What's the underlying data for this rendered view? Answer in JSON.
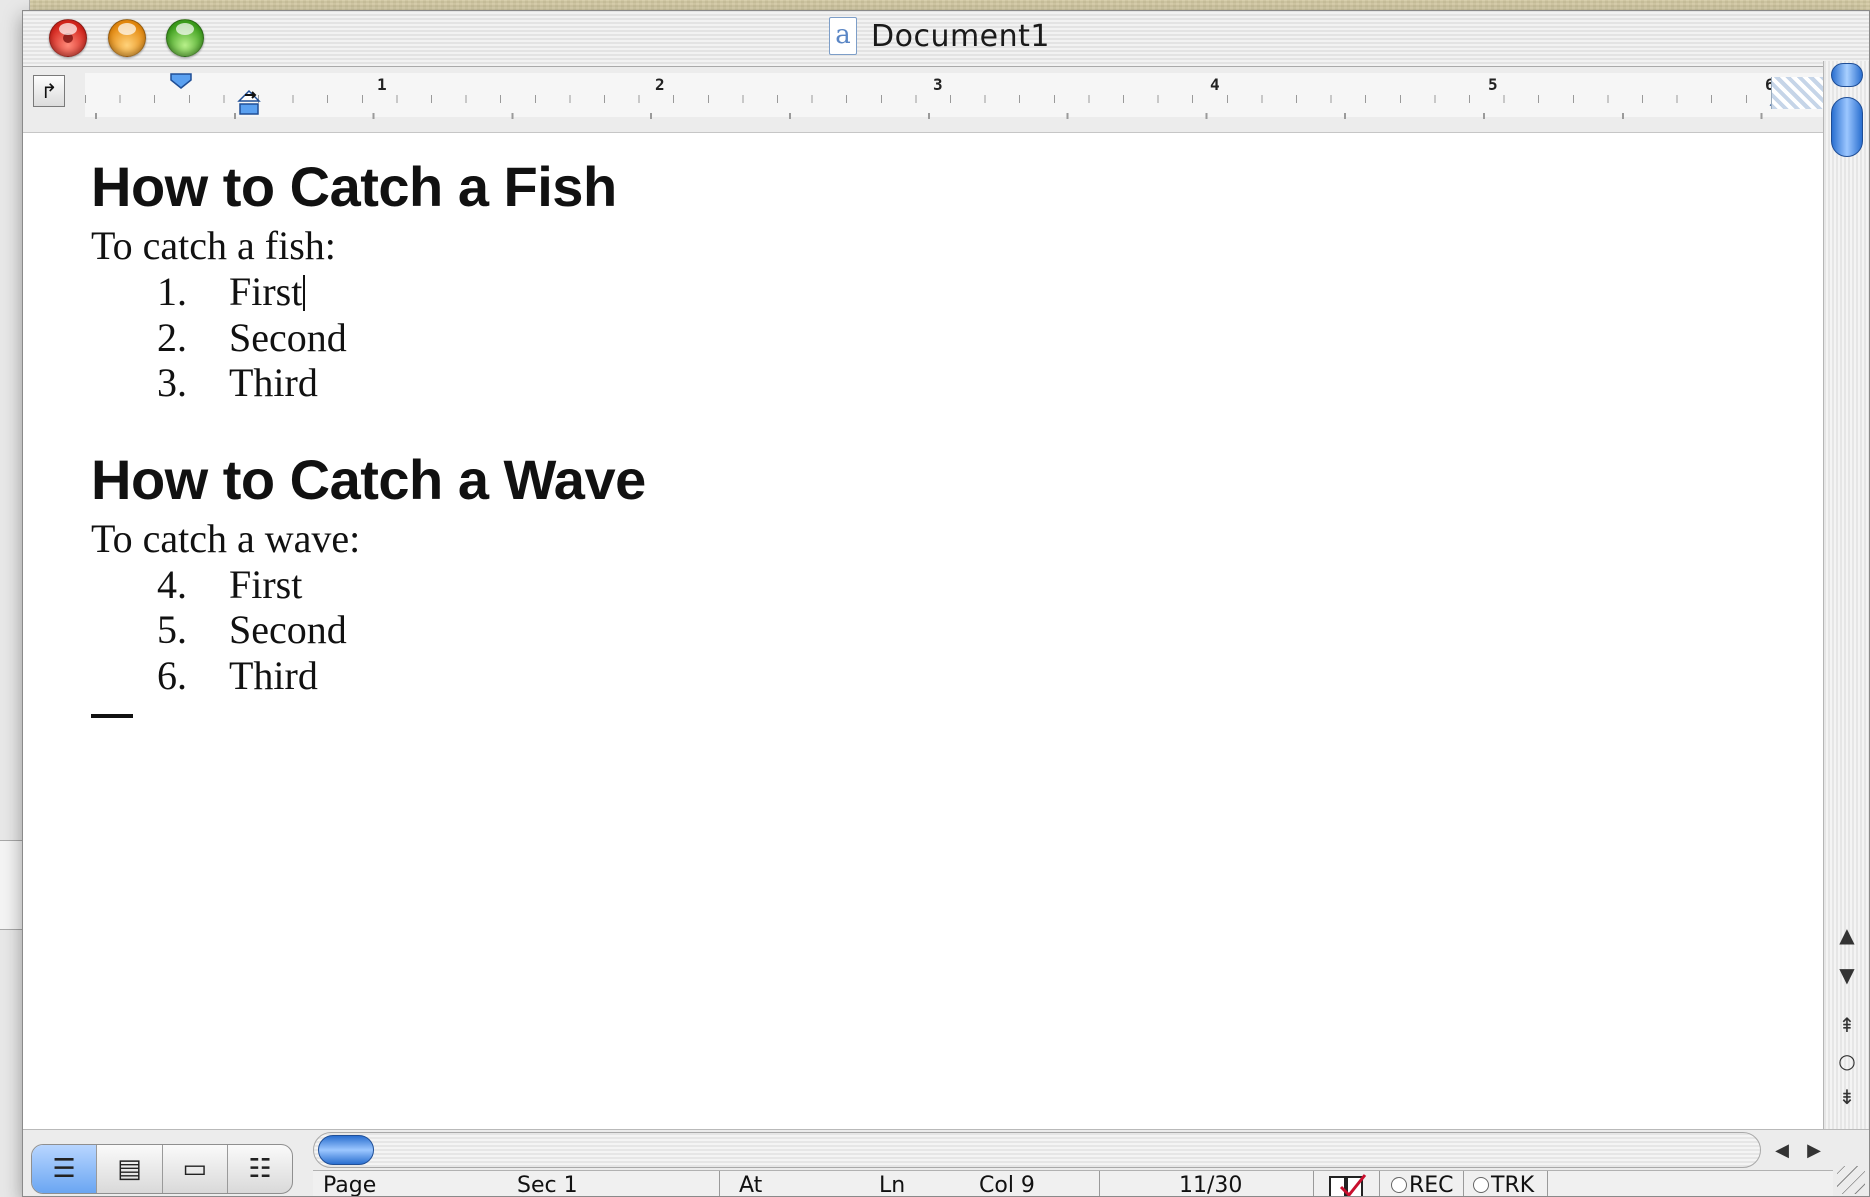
{
  "window": {
    "title": "Document1",
    "doc_icon_glyph": "a"
  },
  "ruler": {
    "numbers": [
      "1",
      "2",
      "3",
      "4",
      "5",
      "6"
    ]
  },
  "document": {
    "sections": [
      {
        "heading": "How to Catch a Fish",
        "intro": "To catch a fish:",
        "items": [
          {
            "num": "1.",
            "text": "First"
          },
          {
            "num": "2.",
            "text": "Second"
          },
          {
            "num": "3.",
            "text": "Third"
          }
        ]
      },
      {
        "heading": "How to Catch a Wave",
        "intro": "To catch a wave:",
        "items": [
          {
            "num": "4.",
            "text": "First"
          },
          {
            "num": "5.",
            "text": "Second"
          },
          {
            "num": "6.",
            "text": "Third"
          }
        ]
      }
    ]
  },
  "statusbar": {
    "page": "Page",
    "sec": "Sec 1",
    "at": "At",
    "ln": "Ln",
    "col": "Col 9",
    "page_count": "11/30",
    "rec": "REC",
    "trk": "TRK"
  },
  "icons": {
    "close": "close-icon",
    "minimize": "minimize-icon",
    "zoom": "zoom-icon",
    "tab_selector": "tab-selector-icon",
    "normal_view": "normal-view-icon",
    "online_view": "online-layout-view-icon",
    "page_view": "page-layout-view-icon",
    "outline_view": "outline-view-icon",
    "spelling": "spelling-book-icon"
  },
  "colors": {
    "accent": "#2a6fd0",
    "close": "#d3231b",
    "minimize": "#e4880e",
    "zoom": "#3c9e1c"
  }
}
